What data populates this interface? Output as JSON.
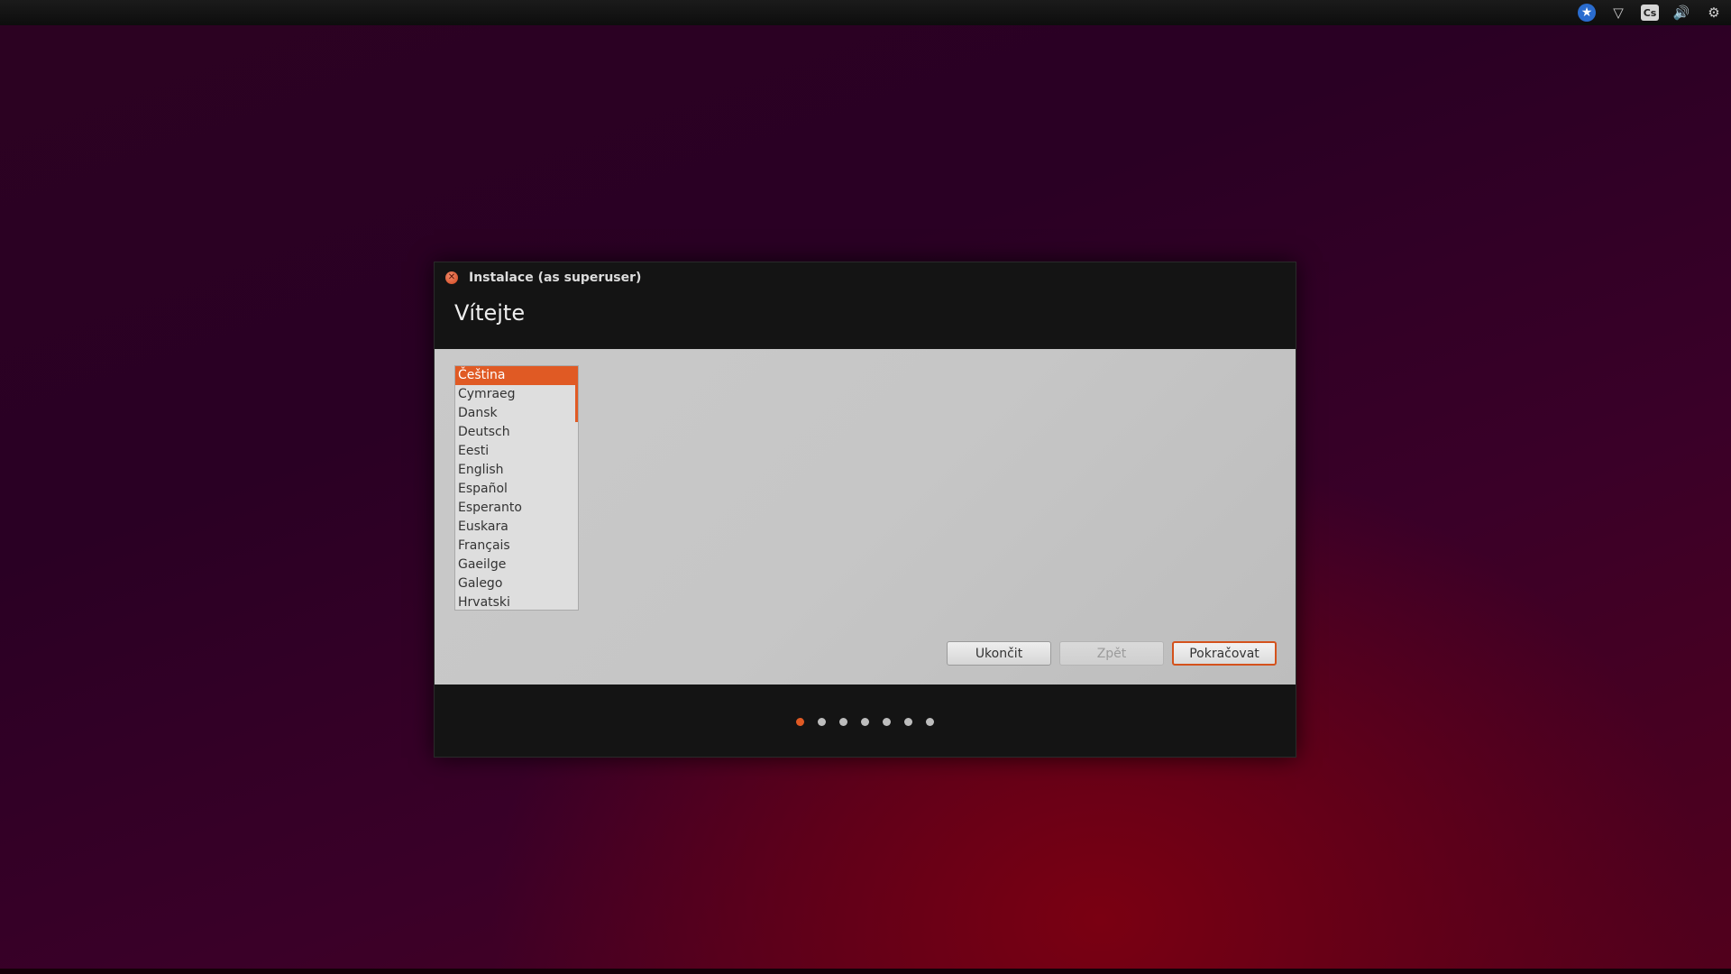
{
  "topbar": {
    "icons": [
      "accessibility-icon",
      "network-icon",
      "keyboard-layout-icon",
      "volume-icon",
      "settings-icon"
    ],
    "keyboard_label": "Cs"
  },
  "window": {
    "title": "Instalace (as superuser)",
    "heading": "Vítejte",
    "languages": [
      "Čeština",
      "Cymraeg",
      "Dansk",
      "Deutsch",
      "Eesti",
      "English",
      "Español",
      "Esperanto",
      "Euskara",
      "Français",
      "Gaeilge",
      "Galego",
      "Hrvatski"
    ],
    "selected_language": "Čeština",
    "buttons": {
      "quit": "Ukončit",
      "back": "Zpět",
      "continue": "Pokračovat"
    },
    "progress": {
      "total_steps": 7,
      "current_step": 1
    }
  },
  "colors": {
    "accent": "#e05a24",
    "window_bg": "#141414",
    "content_bg": "#c9c9c9"
  }
}
